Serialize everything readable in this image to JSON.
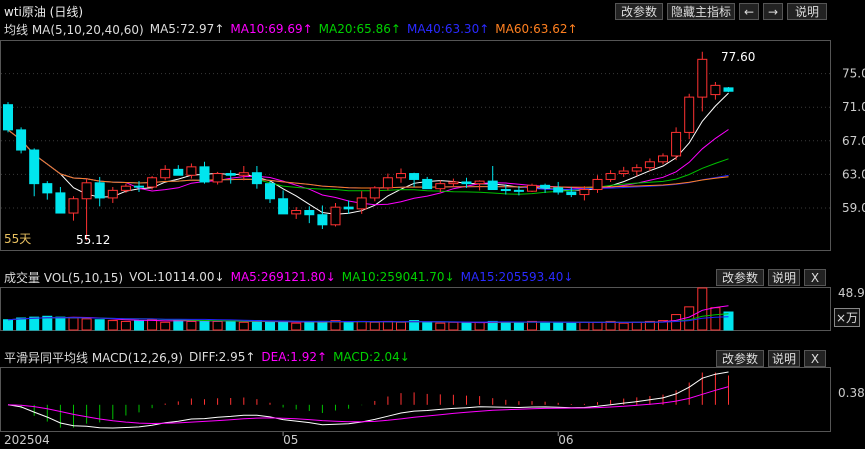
{
  "title": "wti原油 (日线)",
  "toolbar": {
    "modify": "改参数",
    "hide_indicator": "隐藏主指标",
    "prev": "←",
    "next": "→",
    "explain": "说明"
  },
  "main_legend": {
    "label": "均线 MA(5,10,20,40,60)",
    "ma5": "MA5:72.97↑",
    "ma10": "MA10:69.69↑",
    "ma20": "MA20:65.86↑",
    "ma40": "MA40:63.30↑",
    "ma60": "MA60:63.62↑"
  },
  "vol_legend": {
    "label": "成交量 VOL(5,10,15)",
    "vol": "VOL:10114.00↓",
    "ma5": "MA5:269121.80↓",
    "ma10": "MA10:259041.70↓",
    "ma15": "MA15:205593.40↓"
  },
  "macd_legend": {
    "label": "平滑异同平均线 MACD(12,26,9)",
    "diff": "DIFF:2.95↑",
    "dea": "DEA:1.92↑",
    "macd": "MACD:2.04↓"
  },
  "panel_buttons": {
    "modify": "改参数",
    "explain": "说明",
    "close": "X"
  },
  "annotations": {
    "high": "77.60",
    "low": "55.12",
    "days": "55天"
  },
  "vol_axis": {
    "top": "48.99",
    "unit": "×万"
  },
  "macd_axis": {
    "value": "0.38"
  },
  "colors": {
    "up": "#ff3232",
    "down": "#00e5ee",
    "ma5": "#ffffff",
    "ma10": "#ff00ff",
    "ma20": "#00c000",
    "ma40": "#2020ff",
    "ma60": "#ff8020"
  },
  "chart_data": {
    "type": "candlestick",
    "dates": [
      "2025-04-01",
      "2025-04-02",
      "2025-04-03",
      "2025-04-04",
      "2025-04-07",
      "2025-04-08",
      "2025-04-09",
      "2025-04-10",
      "2025-04-11",
      "2025-04-14",
      "2025-04-15",
      "2025-04-16",
      "2025-04-17",
      "2025-04-21",
      "2025-04-22",
      "2025-04-23",
      "2025-04-24",
      "2025-04-25",
      "2025-04-28",
      "2025-04-29",
      "2025-04-30",
      "2025-05-01",
      "2025-05-02",
      "2025-05-05",
      "2025-05-06",
      "2025-05-07",
      "2025-05-08",
      "2025-05-09",
      "2025-05-12",
      "2025-05-13",
      "2025-05-14",
      "2025-05-15",
      "2025-05-16",
      "2025-05-19",
      "2025-05-20",
      "2025-05-21",
      "2025-05-22",
      "2025-05-23",
      "2025-05-27",
      "2025-05-28",
      "2025-05-29",
      "2025-05-30",
      "2025-06-02",
      "2025-06-03",
      "2025-06-04",
      "2025-06-05",
      "2025-06-06",
      "2025-06-09",
      "2025-06-10",
      "2025-06-11",
      "2025-06-12",
      "2025-06-13",
      "2025-06-16",
      "2025-06-17",
      "2025-06-18",
      "2025-06-19"
    ],
    "x_tick_labels": [
      "202504",
      "05",
      "06"
    ],
    "y_ticks": [
      59.0,
      63.0,
      67.0,
      71.0,
      75.0
    ],
    "ylim": [
      54.0,
      79.0
    ],
    "candles": [
      [
        71.3,
        71.6,
        68.0,
        68.3
      ],
      [
        68.3,
        68.6,
        65.5,
        65.9
      ],
      [
        65.9,
        66.1,
        60.4,
        61.9
      ],
      [
        61.9,
        62.2,
        60.0,
        60.8
      ],
      [
        60.8,
        61.5,
        58.6,
        58.4
      ],
      [
        58.4,
        60.4,
        57.5,
        60.1
      ],
      [
        60.1,
        62.5,
        55.12,
        62.0
      ],
      [
        62.0,
        62.7,
        59.2,
        60.2
      ],
      [
        60.2,
        61.5,
        59.6,
        61.1
      ],
      [
        61.1,
        61.9,
        60.8,
        61.6
      ],
      [
        61.6,
        62.2,
        60.9,
        61.5
      ],
      [
        61.5,
        62.8,
        61.2,
        62.6
      ],
      [
        62.6,
        64.1,
        62.3,
        63.6
      ],
      [
        63.6,
        64.1,
        63.0,
        62.9
      ],
      [
        62.9,
        64.3,
        62.5,
        63.9
      ],
      [
        63.9,
        64.5,
        61.9,
        62.1
      ],
      [
        62.1,
        63.3,
        61.8,
        63.1
      ],
      [
        63.1,
        63.5,
        61.9,
        62.9
      ],
      [
        62.9,
        64.0,
        62.3,
        63.2
      ],
      [
        63.2,
        64.0,
        61.3,
        61.9
      ],
      [
        61.9,
        62.2,
        59.6,
        60.1
      ],
      [
        60.1,
        61.1,
        58.6,
        58.3
      ],
      [
        58.3,
        59.1,
        57.7,
        58.7
      ],
      [
        58.7,
        59.2,
        57.2,
        58.2
      ],
      [
        58.2,
        59.3,
        56.5,
        57.0
      ],
      [
        57.0,
        59.6,
        56.8,
        59.1
      ],
      [
        59.1,
        59.9,
        58.3,
        58.9
      ],
      [
        58.9,
        61.0,
        58.3,
        60.2
      ],
      [
        60.2,
        61.6,
        59.8,
        61.4
      ],
      [
        61.4,
        63.1,
        61.1,
        62.6
      ],
      [
        62.6,
        63.7,
        62.0,
        63.1
      ],
      [
        63.1,
        63.2,
        61.5,
        62.4
      ],
      [
        62.4,
        62.7,
        61.8,
        61.3
      ],
      [
        61.3,
        62.3,
        60.9,
        61.9
      ],
      [
        61.9,
        62.5,
        61.5,
        62.1
      ],
      [
        62.1,
        62.6,
        61.4,
        61.9
      ],
      [
        61.9,
        62.3,
        61.1,
        62.2
      ],
      [
        62.2,
        64.0,
        61.7,
        61.2
      ],
      [
        61.2,
        61.8,
        60.6,
        61.1
      ],
      [
        61.1,
        61.6,
        60.5,
        61.0
      ],
      [
        61.0,
        61.9,
        60.9,
        61.7
      ],
      [
        61.7,
        61.9,
        60.8,
        61.4
      ],
      [
        61.4,
        62.1,
        60.6,
        60.9
      ],
      [
        60.9,
        61.5,
        60.3,
        60.6
      ],
      [
        60.6,
        61.6,
        59.9,
        61.2
      ],
      [
        61.2,
        62.9,
        60.8,
        62.4
      ],
      [
        62.4,
        63.5,
        62.1,
        63.1
      ],
      [
        63.1,
        63.9,
        62.7,
        63.4
      ],
      [
        63.4,
        64.2,
        62.8,
        63.8
      ],
      [
        63.8,
        64.9,
        63.4,
        64.5
      ],
      [
        64.5,
        65.5,
        64.2,
        65.2
      ],
      [
        65.2,
        68.6,
        64.7,
        68.0
      ],
      [
        68.0,
        72.6,
        67.2,
        72.2
      ],
      [
        72.2,
        77.6,
        70.5,
        76.7
      ],
      [
        72.5,
        74.0,
        71.9,
        73.6
      ],
      [
        73.3,
        73.4,
        72.8,
        72.9
      ]
    ],
    "volume_ylim": [
      0,
      49
    ],
    "volume": [
      12,
      14,
      15,
      16,
      15,
      14,
      13,
      12,
      11,
      10,
      11,
      12,
      9,
      12,
      10,
      11,
      10,
      10,
      9,
      11,
      9,
      10,
      8,
      9,
      10,
      11,
      9,
      10,
      9,
      10,
      9,
      11,
      9,
      8,
      9,
      8,
      9,
      10,
      9,
      9,
      10,
      9,
      9,
      8,
      9,
      9,
      10,
      8,
      9,
      10,
      11,
      18,
      27,
      49,
      26,
      21,
      9
    ]
  }
}
